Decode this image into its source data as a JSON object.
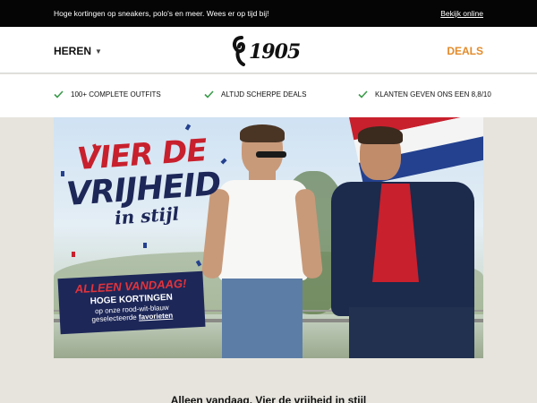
{
  "topbar": {
    "promo": "Hoge kortingen op sneakers, polo's en meer. Wees er op tijd bij!",
    "view_online": "Bekijk online"
  },
  "header": {
    "menu_label": "HEREN",
    "logo_text": "1905",
    "deals_label": "DEALS"
  },
  "usp": [
    {
      "text": "100+ COMPLETE OUTFITS",
      "icon": "check-icon"
    },
    {
      "text": "ALTIJD SCHERPE DEALS",
      "icon": "check-icon"
    },
    {
      "text": "KLANTEN GEVEN ONS EEN 8,8/10",
      "icon": "check-icon"
    }
  ],
  "hero": {
    "headline_line1": "VIER DE",
    "headline_line2": "VRIJHEID",
    "headline_line3": "in stijl",
    "badge_title": "ALLEEN VANDAAG!",
    "badge_subtitle": "HOGE KORTINGEN",
    "badge_text": "op onze rood-wit-blauw",
    "badge_text2": "geselecteerde",
    "badge_link": "favorieten"
  },
  "caption": "Alleen vandaag. Vier de vrijheid in stijl",
  "colors": {
    "topbar_bg": "#050505",
    "accent_orange": "#e38b2a",
    "check_green": "#3a9a4a",
    "navy": "#1d2758",
    "red": "#c8202d",
    "page_bg": "#e6e4dd"
  }
}
